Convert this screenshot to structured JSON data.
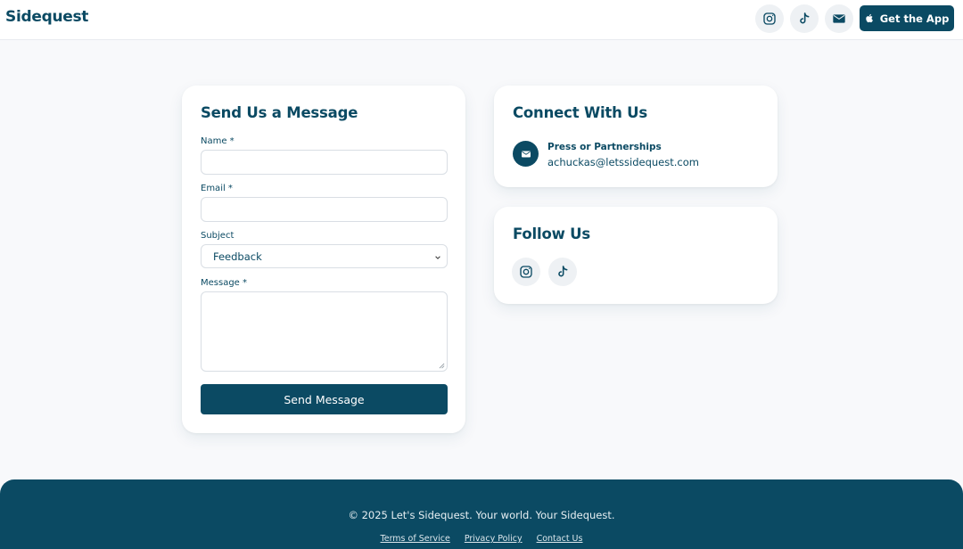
{
  "header": {
    "brand": "Sidequest",
    "get_app_label": "Get the App",
    "icons": [
      "instagram-icon",
      "tiktok-icon",
      "mail-icon",
      "apple-icon"
    ]
  },
  "form": {
    "title": "Send Us a Message",
    "name_label": "Name *",
    "name_value": "",
    "email_label": "Email *",
    "email_value": "",
    "subject_label": "Subject",
    "subject_value": "Feedback",
    "message_label": "Message *",
    "message_value": "",
    "submit_label": "Send Message"
  },
  "connect": {
    "title": "Connect With Us",
    "contact_label": "Press or Partnerships",
    "contact_email": "achuckas@letssidequest.com"
  },
  "follow": {
    "title": "Follow Us",
    "icons": [
      "instagram-icon",
      "tiktok-icon"
    ]
  },
  "footer": {
    "copyright": "© 2025 Let's Sidequest. Your world. Your Sidequest.",
    "links": [
      "Terms of Service",
      "Privacy Policy",
      "Contact Us"
    ]
  },
  "colors": {
    "brand": "#0b4a63",
    "background": "#f8f9fb",
    "card": "#ffffff",
    "icon_bg": "#eef1f4"
  }
}
